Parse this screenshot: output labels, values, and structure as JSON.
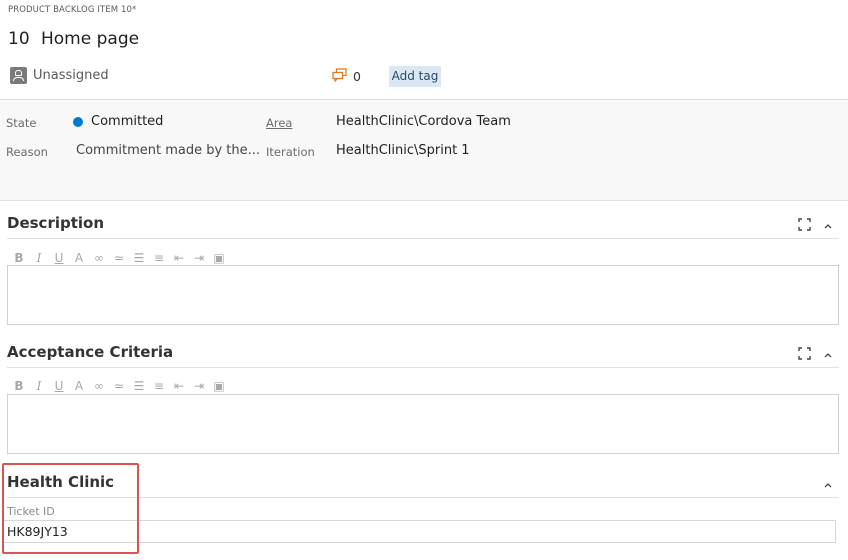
{
  "header": {
    "item_type": "PRODUCT BACKLOG ITEM 10*",
    "id": "10",
    "title": "Home page",
    "assigned_to": "Unassigned",
    "comment_count": "0",
    "add_tag_label": "Add tag"
  },
  "details": {
    "state_label": "State",
    "state_value": "Committed",
    "state_color": "#007acc",
    "reason_label": "Reason",
    "reason_value": "Commitment made by the...",
    "area_label": "Area",
    "area_value": "HealthClinic\\Cordova Team",
    "iteration_label": "Iteration",
    "iteration_value": "HealthClinic\\Sprint 1"
  },
  "toolbar_icons": [
    "bold-icon",
    "italic-icon",
    "underline-icon",
    "highlight-icon",
    "link-icon",
    "unlink-icon",
    "bullet-list-icon",
    "numbered-list-icon",
    "outdent-icon",
    "indent-icon",
    "image-icon"
  ],
  "sections": {
    "description_title": "Description",
    "acceptance_title": "Acceptance Criteria",
    "health_clinic_title": "Health Clinic",
    "ticket_label": "Ticket ID",
    "ticket_value": "HK89JY13"
  },
  "colors": {
    "highlight_border": "#d9534f",
    "tag_bg": "#dbe8f3",
    "comment_icon": "#e07b24"
  }
}
